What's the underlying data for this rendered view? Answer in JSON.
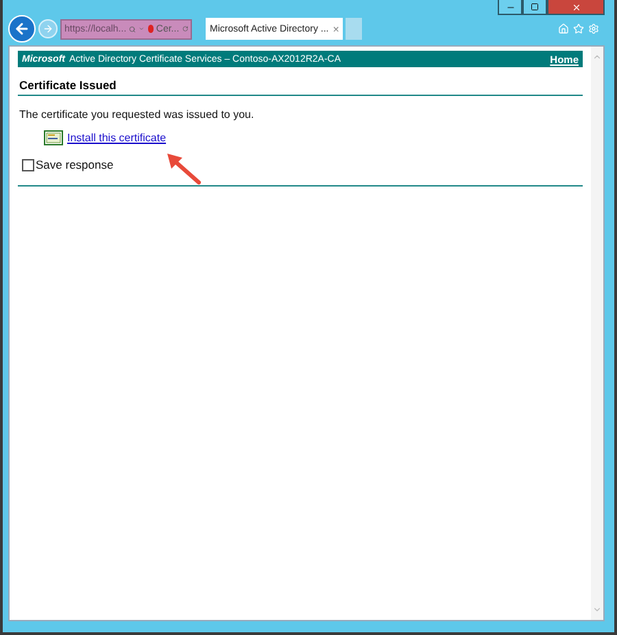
{
  "address_bar": {
    "url": "https://localh...",
    "site_tab": "Cer..."
  },
  "tabs": [
    {
      "title": "Microsoft Active Directory ...",
      "close": "×",
      "selected": true
    }
  ],
  "page": {
    "banner": {
      "brand": "Microsoft",
      "title": "Active Directory Certificate Services  –  Contoso-AX2012R2A-CA",
      "home_link": "Home"
    },
    "heading": "Certificate Issued",
    "message": "The certificate you requested was issued to you.",
    "install_link": "Install this certificate",
    "save_response": {
      "label": "Save response",
      "checked": false
    }
  }
}
